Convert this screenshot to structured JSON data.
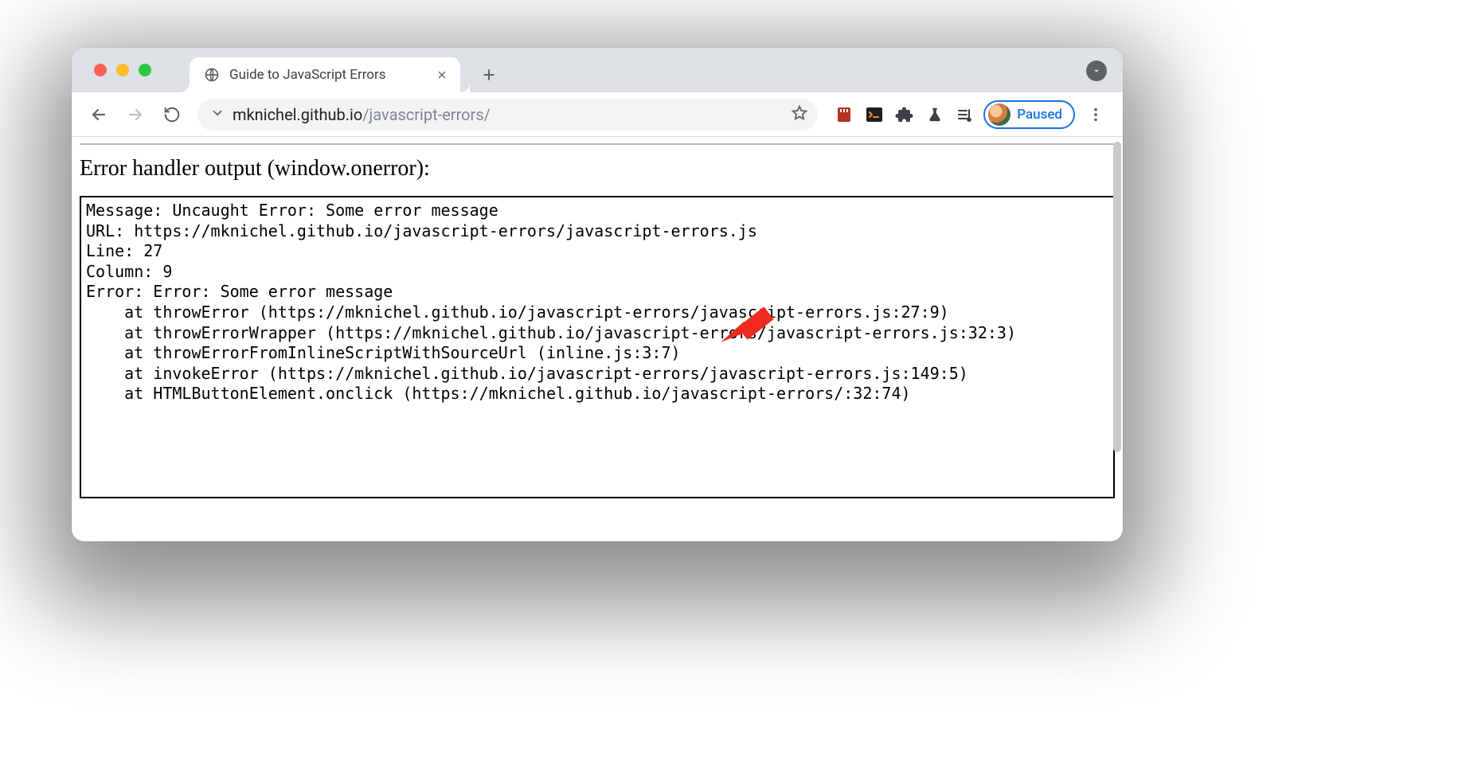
{
  "window": {
    "tab_title": "Guide to JavaScript Errors"
  },
  "toolbar": {
    "url_host": "mknichel.github.io",
    "url_path": "/javascript-errors/",
    "profile_label": "Paused"
  },
  "page": {
    "heading": "Error handler output (window.onerror):",
    "output": "Message: Uncaught Error: Some error message\nURL: https://mknichel.github.io/javascript-errors/javascript-errors.js\nLine: 27\nColumn: 9\nError: Error: Some error message\n    at throwError (https://mknichel.github.io/javascript-errors/javascript-errors.js:27:9)\n    at throwErrorWrapper (https://mknichel.github.io/javascript-errors/javascript-errors.js:32:3)\n    at throwErrorFromInlineScriptWithSourceUrl (inline.js:3:7)\n    at invokeError (https://mknichel.github.io/javascript-errors/javascript-errors.js:149:5)\n    at HTMLButtonElement.onclick (https://mknichel.github.io/javascript-errors/:32:74)"
  }
}
